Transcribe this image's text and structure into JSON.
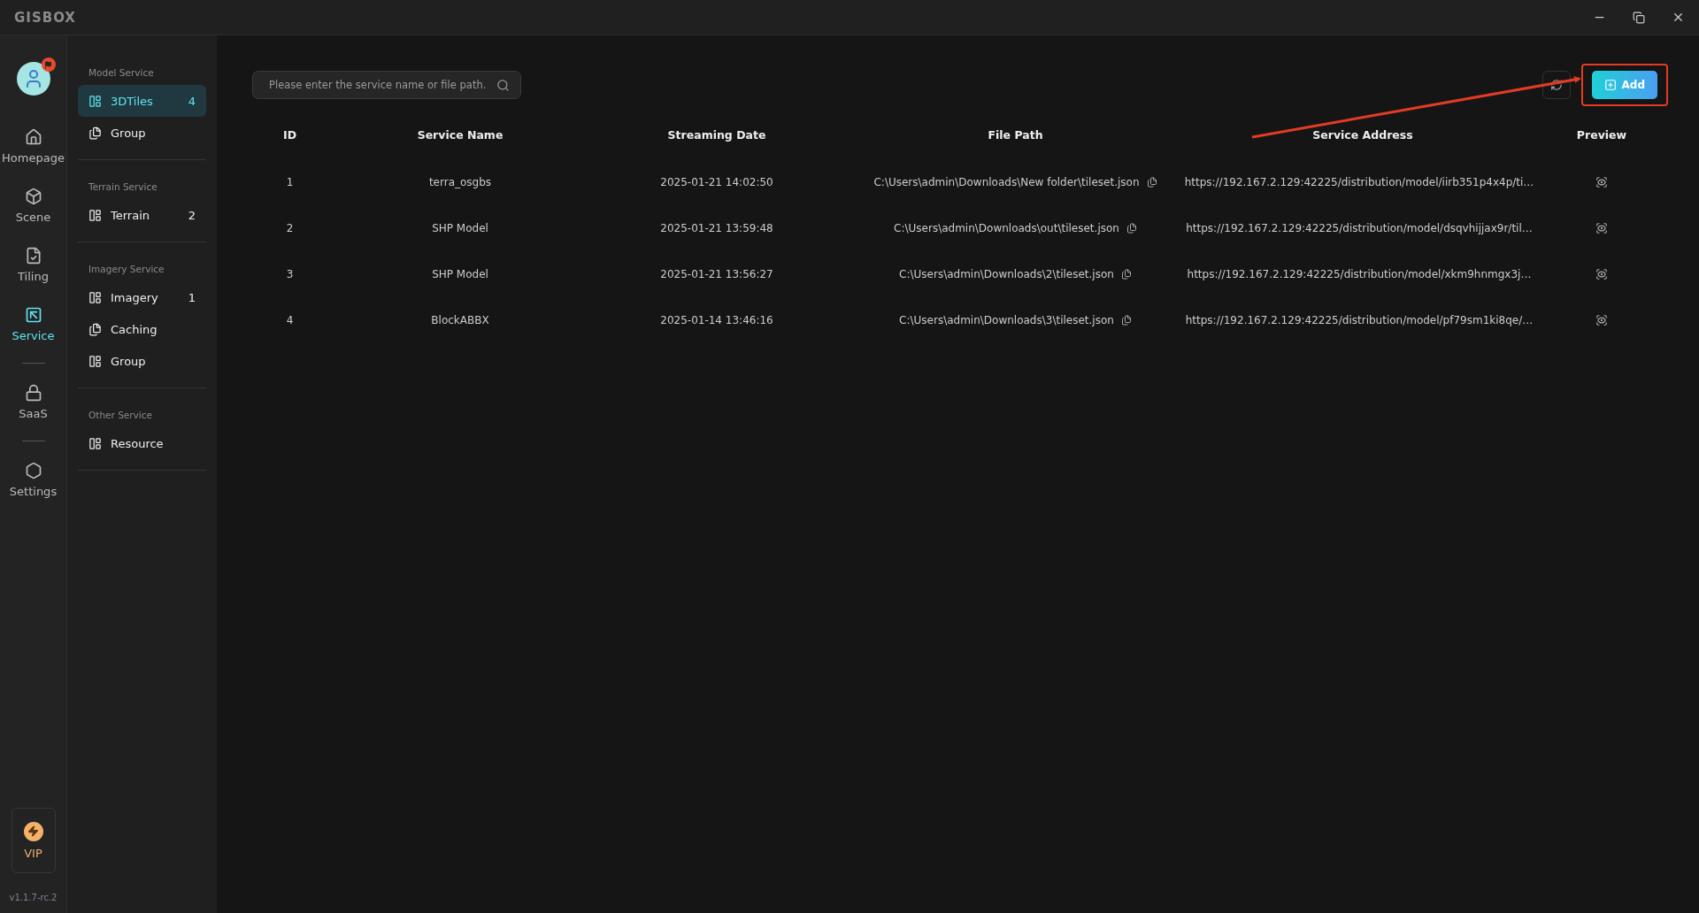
{
  "window": {
    "logo": "GISBOX"
  },
  "nav": {
    "items": [
      {
        "label": "Homepage",
        "selected": false
      },
      {
        "label": "Scene",
        "selected": false
      },
      {
        "label": "Tiling",
        "selected": false
      },
      {
        "label": "Service",
        "selected": true
      },
      {
        "label": "SaaS",
        "selected": false
      },
      {
        "label": "Settings",
        "selected": false
      }
    ],
    "vip": "VIP",
    "version": "v1.1.7-rc.2"
  },
  "sidebar": {
    "sections": [
      {
        "title": "Model Service",
        "items": [
          {
            "label": "3DTiles",
            "count": "4",
            "selected": true
          },
          {
            "label": "Group",
            "selected": false
          }
        ]
      },
      {
        "title": "Terrain Service",
        "items": [
          {
            "label": "Terrain",
            "count": "2",
            "selected": false
          }
        ]
      },
      {
        "title": "Imagery Service",
        "items": [
          {
            "label": "Imagery",
            "count": "1",
            "selected": false
          },
          {
            "label": "Caching",
            "selected": false
          },
          {
            "label": "Group",
            "selected": false
          }
        ]
      },
      {
        "title": "Other Service",
        "items": [
          {
            "label": "Resource",
            "selected": false
          }
        ]
      }
    ]
  },
  "search": {
    "placeholder": "Please enter the service name or file path."
  },
  "add_button": "Add",
  "table": {
    "columns": [
      "ID",
      "Service Name",
      "Streaming Date",
      "File Path",
      "Service Address",
      "Preview"
    ],
    "rows": [
      {
        "id": "1",
        "name": "terra_osgbs",
        "date": "2025-01-21 14:02:50",
        "path": "C:\\Users\\admin\\Downloads\\New folder\\tileset.json",
        "address": "https://192.167.2.129:42225/distribution/model/iirb351p4x4p/ti…"
      },
      {
        "id": "2",
        "name": "SHP Model",
        "date": "2025-01-21 13:59:48",
        "path": "C:\\Users\\admin\\Downloads\\out\\tileset.json",
        "address": "https://192.167.2.129:42225/distribution/model/dsqvhijjax9r/til…"
      },
      {
        "id": "3",
        "name": "SHP Model",
        "date": "2025-01-21 13:56:27",
        "path": "C:\\Users\\admin\\Downloads\\2\\tileset.json",
        "address": "https://192.167.2.129:42225/distribution/model/xkm9hnmgx3j…"
      },
      {
        "id": "4",
        "name": "BlockABBX",
        "date": "2025-01-14 13:46:16",
        "path": "C:\\Users\\admin\\Downloads\\3\\tileset.json",
        "address": "https://192.167.2.129:42225/distribution/model/pf79sm1ki8qe/…"
      }
    ]
  }
}
